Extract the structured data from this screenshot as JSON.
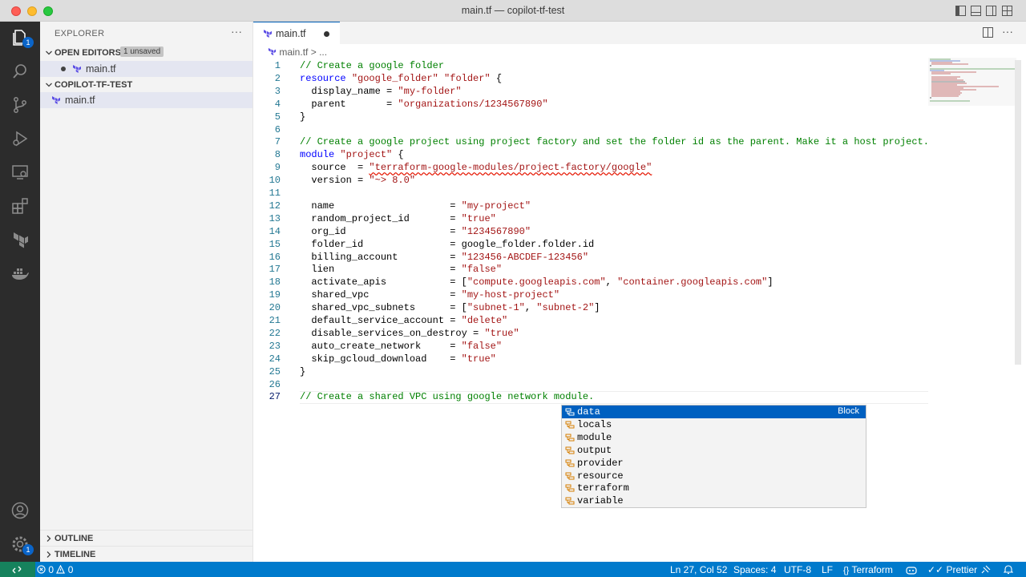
{
  "window": {
    "title": "main.tf — copilot-tf-test"
  },
  "sidebar": {
    "title": "EXPLORER",
    "more": "···",
    "open_editors": {
      "label": "OPEN EDITORS",
      "badge": "1 unsaved",
      "file": "main.tf"
    },
    "project": {
      "label": "COPILOT-TF-TEST",
      "file": "main.tf"
    },
    "outline": "OUTLINE",
    "timeline": "TIMELINE"
  },
  "activity": {
    "explorer_badge": "1",
    "manage_badge": "1"
  },
  "editor": {
    "tab": {
      "name": "main.tf"
    },
    "breadcrumb": {
      "file": "main.tf",
      "sep": ">",
      "rest": "..."
    }
  },
  "code": [
    {
      "n": "1",
      "t": "// Create a google folder"
    },
    {
      "n": "2",
      "t": "resource \"google_folder\" \"folder\" {"
    },
    {
      "n": "3",
      "t": "  display_name = \"my-folder\""
    },
    {
      "n": "4",
      "t": "  parent       = \"organizations/1234567890\""
    },
    {
      "n": "5",
      "t": "}"
    },
    {
      "n": "6",
      "t": ""
    },
    {
      "n": "7",
      "t": "// Create a google project using project factory and set the folder id as the parent. Make it a host project."
    },
    {
      "n": "8",
      "t": "module \"project\" {"
    },
    {
      "n": "9",
      "t": "  source  = \"terraform-google-modules/project-factory/google\""
    },
    {
      "n": "10",
      "t": "  version = \"~> 8.0\""
    },
    {
      "n": "11",
      "t": ""
    },
    {
      "n": "12",
      "t": "  name                    = \"my-project\""
    },
    {
      "n": "13",
      "t": "  random_project_id       = \"true\""
    },
    {
      "n": "14",
      "t": "  org_id                  = \"1234567890\""
    },
    {
      "n": "15",
      "t": "  folder_id               = google_folder.folder.id"
    },
    {
      "n": "16",
      "t": "  billing_account         = \"123456-ABCDEF-123456\""
    },
    {
      "n": "17",
      "t": "  lien                    = \"false\""
    },
    {
      "n": "18",
      "t": "  activate_apis           = [\"compute.googleapis.com\", \"container.googleapis.com\"]"
    },
    {
      "n": "19",
      "t": "  shared_vpc              = \"my-host-project\""
    },
    {
      "n": "20",
      "t": "  shared_vpc_subnets      = [\"subnet-1\", \"subnet-2\"]"
    },
    {
      "n": "21",
      "t": "  default_service_account = \"delete\""
    },
    {
      "n": "22",
      "t": "  disable_services_on_destroy = \"true\""
    },
    {
      "n": "23",
      "t": "  auto_create_network     = \"false\""
    },
    {
      "n": "24",
      "t": "  skip_gcloud_download    = \"true\""
    },
    {
      "n": "25",
      "t": "}"
    },
    {
      "n": "26",
      "t": ""
    },
    {
      "n": "27",
      "t": "// Create a shared VPC using google network module."
    }
  ],
  "suggest": {
    "detail": "Block",
    "items": [
      "data",
      "locals",
      "module",
      "output",
      "provider",
      "resource",
      "terraform",
      "variable"
    ]
  },
  "status": {
    "errors": "0",
    "warnings": "0",
    "position": "Ln 27, Col 52",
    "spaces": "Spaces: 4",
    "encoding": "UTF-8",
    "eol": "LF",
    "language": "Terraform",
    "prettier": "Prettier"
  },
  "colors": {
    "accent": "#007acc",
    "remote": "#16825d",
    "selection": "#0060c0",
    "activitybar": "#2c2c2c"
  }
}
